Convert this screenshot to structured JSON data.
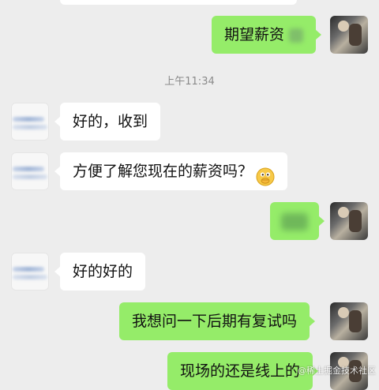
{
  "chat": {
    "timestamp": "上午11:34",
    "messages": [
      {
        "side": "out",
        "text": "期望薪资"
      },
      {
        "side": "in",
        "text": "好的，收到"
      },
      {
        "side": "in",
        "text": "方便了解您现在的薪资吗？"
      },
      {
        "side": "out",
        "text": ""
      },
      {
        "side": "in",
        "text": "好的好的"
      },
      {
        "side": "out",
        "text": "我想问一下后期有复试吗"
      },
      {
        "side": "out",
        "text": "现场的还是线上的"
      }
    ]
  },
  "watermark": "@稀土掘金技术社区",
  "colors": {
    "background": "#ededed",
    "outgoing_bubble": "#95ec69",
    "incoming_bubble": "#ffffff"
  },
  "icons": {
    "emoji": "hand-over-mouth-emoji"
  }
}
